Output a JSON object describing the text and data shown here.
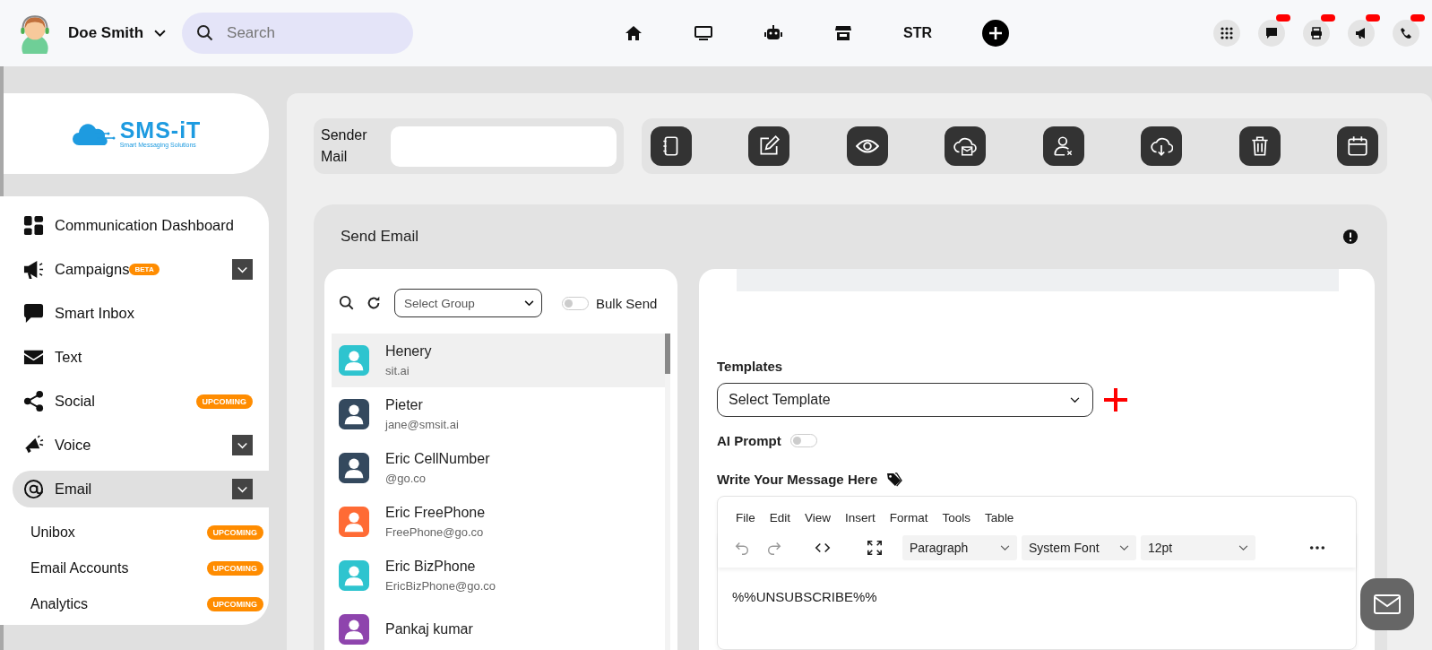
{
  "topbar": {
    "user_name": "Doe Smith",
    "search": {
      "placeholder": "Search"
    },
    "nav": [
      {
        "kind": "home"
      },
      {
        "kind": "monitor"
      },
      {
        "kind": "robot"
      },
      {
        "kind": "store"
      },
      {
        "kind": "text",
        "label": "STR"
      },
      {
        "kind": "plus"
      }
    ],
    "actions": [
      {
        "kind": "apps",
        "badge": false
      },
      {
        "kind": "chat",
        "badge": true
      },
      {
        "kind": "printer",
        "badge": true
      },
      {
        "kind": "megaphone",
        "badge": true
      },
      {
        "kind": "phone",
        "badge": true
      }
    ]
  },
  "sidebar": {
    "logo": {
      "name": "SMS-iT",
      "tagline": "Smart Messaging Solutions"
    },
    "items": [
      {
        "kind": "dashboard",
        "label": "Communication Dashboard",
        "selected": false,
        "expandable": false
      },
      {
        "kind": "megaphone",
        "label": "Campaigns",
        "badge": "BETA",
        "selected": false,
        "expandable": true
      },
      {
        "kind": "chat",
        "label": "Smart Inbox",
        "selected": false,
        "expandable": false
      },
      {
        "kind": "envelope",
        "label": "Text",
        "selected": false,
        "expandable": false
      },
      {
        "kind": "share",
        "label": "Social",
        "badge": "UPCOMING",
        "selected": false,
        "expandable": false
      },
      {
        "kind": "voice",
        "label": "Voice",
        "selected": false,
        "expandable": true
      },
      {
        "kind": "at",
        "label": "Email",
        "selected": true,
        "expandable": true,
        "children": [
          {
            "label": "Unibox",
            "badge": "UPCOMING"
          },
          {
            "label": "Email Accounts",
            "badge": "UPCOMING"
          },
          {
            "label": "Analytics",
            "badge": "UPCOMING"
          }
        ]
      }
    ]
  },
  "sender": {
    "label": "Sender Mail"
  },
  "send_email": {
    "title": "Send Email",
    "contacts": {
      "group_select": {
        "placeholder": "Select Group"
      },
      "bulk_send": {
        "label": "Bulk Send",
        "on": false
      },
      "items": [
        {
          "name": "Henery",
          "email": "sit.ai",
          "color": "#2ec4cf",
          "selected": true
        },
        {
          "name": "Pieter",
          "email": "jane@smsit.ai",
          "color": "#34495e",
          "selected": false
        },
        {
          "name": "Eric CellNumber",
          "email": "@go.co",
          "color": "#34495e",
          "selected": false
        },
        {
          "name": "Eric FreePhone",
          "email": "FreePhone@go.co",
          "color": "#ff6b35",
          "selected": false
        },
        {
          "name": "Eric BizPhone",
          "email": "EricBizPhone@go.co",
          "color": "#2ec4cf",
          "selected": false
        },
        {
          "name": "Pankaj kumar",
          "color": "#8e44ad",
          "selected": false
        }
      ]
    },
    "templates": {
      "label": "Templates",
      "placeholder": "Select Template"
    },
    "ai_prompt": {
      "label": "AI Prompt",
      "on": false
    },
    "message": {
      "label": "Write Your Message Here",
      "menu": [
        "File",
        "Edit",
        "View",
        "Insert",
        "Format",
        "Tools",
        "Table"
      ],
      "selects": [
        "Paragraph",
        "System Font",
        "12pt"
      ],
      "body": "%%UNSUBSCRIBE%%"
    }
  }
}
